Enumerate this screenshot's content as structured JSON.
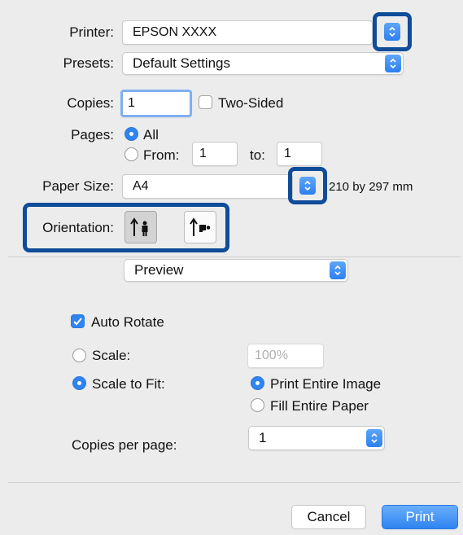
{
  "printer": {
    "label": "Printer:",
    "value": "EPSON XXXX"
  },
  "presets": {
    "label": "Presets:",
    "value": "Default Settings"
  },
  "copies": {
    "label": "Copies:",
    "value": "1",
    "two_sided_label": "Two-Sided",
    "two_sided_checked": false
  },
  "pages": {
    "label": "Pages:",
    "all_label": "All",
    "from_label": "From:",
    "from_value": "1",
    "to_label": "to:",
    "to_value": "1",
    "selected": "all"
  },
  "paper_size": {
    "label": "Paper Size:",
    "value": "A4",
    "dimensions": "210 by 297 mm"
  },
  "orientation": {
    "label": "Orientation:",
    "selected": "portrait"
  },
  "section_popup": {
    "value": "Preview"
  },
  "preview": {
    "auto_rotate_label": "Auto Rotate",
    "auto_rotate_checked": true,
    "scale_label": "Scale:",
    "scale_value": "100%",
    "scale_to_fit_label": "Scale to Fit:",
    "print_entire_image_label": "Print Entire Image",
    "fill_entire_paper_label": "Fill Entire Paper",
    "copies_per_page_label": "Copies per page:",
    "copies_per_page_value": "1"
  },
  "buttons": {
    "cancel": "Cancel",
    "print": "Print"
  },
  "colors": {
    "accent": "#2f84f0",
    "highlight_border": "#0f4c9a",
    "background": "#ececec"
  }
}
